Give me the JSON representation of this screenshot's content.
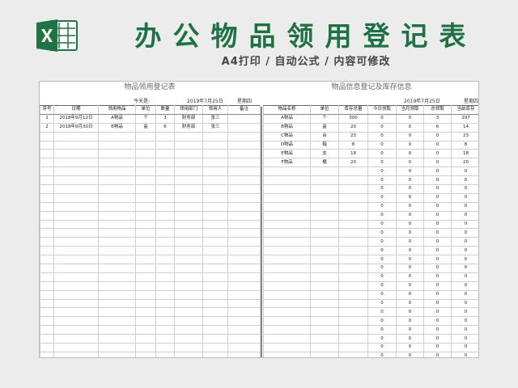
{
  "header": {
    "title": "办公物品领用登记表",
    "subtitle": "A4打印 / 自动公式 / 内容可修改"
  },
  "colors": {
    "brand_green": "#1e7145",
    "logo_green": "#217346"
  },
  "icons": {
    "logo": "excel-logo-icon"
  },
  "left_panel": {
    "title": "物品领用登记表",
    "today_label": "今天是:",
    "date": "2019年7月25日",
    "weekday": "星期四",
    "columns": [
      "序号",
      "日期",
      "领用物品",
      "单位",
      "数量",
      "领用部门",
      "领用人",
      "备注"
    ],
    "rows": [
      [
        "1",
        "2018年9月12日",
        "A物品",
        "个",
        "3",
        "财务部",
        "张三",
        ""
      ],
      [
        "2",
        "2018年9月30日",
        "B物品",
        "盒",
        "6",
        "财务部",
        "张三",
        ""
      ]
    ]
  },
  "right_panel": {
    "title": "物品信息登记及库存信息",
    "date": "2019年7月25日",
    "weekday": "星期四",
    "columns": [
      "物品名称",
      "单位",
      "库存总量",
      "今日领取",
      "当月领取",
      "总领取",
      "当前库存"
    ],
    "rows": [
      [
        "A物品",
        "个",
        "300",
        "0",
        "0",
        "3",
        "297"
      ],
      [
        "B物品",
        "盒",
        "20",
        "0",
        "0",
        "6",
        "14"
      ],
      [
        "C物品",
        "台",
        "23",
        "0",
        "0",
        "0",
        "23"
      ],
      [
        "D物品",
        "箱",
        "8",
        "0",
        "0",
        "0",
        "8"
      ],
      [
        "E物品",
        "支",
        "18",
        "0",
        "0",
        "0",
        "18"
      ],
      [
        "F物品",
        "桶",
        "20",
        "0",
        "0",
        "0",
        "20"
      ],
      [
        "",
        "",
        "",
        "0",
        "0",
        "0",
        "0"
      ],
      [
        "",
        "",
        "",
        "0",
        "0",
        "0",
        "0"
      ],
      [
        "",
        "",
        "",
        "0",
        "0",
        "0",
        "0"
      ],
      [
        "",
        "",
        "",
        "0",
        "0",
        "0",
        "0"
      ],
      [
        "",
        "",
        "",
        "0",
        "0",
        "0",
        "0"
      ],
      [
        "",
        "",
        "",
        "0",
        "0",
        "0",
        "0"
      ],
      [
        "",
        "",
        "",
        "0",
        "0",
        "0",
        "0"
      ],
      [
        "",
        "",
        "",
        "0",
        "0",
        "0",
        "0"
      ],
      [
        "",
        "",
        "",
        "0",
        "0",
        "0",
        "0"
      ],
      [
        "",
        "",
        "",
        "0",
        "0",
        "0",
        "0"
      ],
      [
        "",
        "",
        "",
        "0",
        "0",
        "0",
        "0"
      ],
      [
        "",
        "",
        "",
        "0",
        "0",
        "0",
        "0"
      ],
      [
        "",
        "",
        "",
        "0",
        "0",
        "0",
        "0"
      ],
      [
        "",
        "",
        "",
        "0",
        "0",
        "0",
        "0"
      ],
      [
        "",
        "",
        "",
        "0",
        "0",
        "0",
        "0"
      ],
      [
        "",
        "",
        "",
        "0",
        "0",
        "0",
        "0"
      ],
      [
        "",
        "",
        "",
        "0",
        "0",
        "0",
        "0"
      ],
      [
        "",
        "",
        "",
        "0",
        "0",
        "0",
        "0"
      ],
      [
        "",
        "",
        "",
        "0",
        "0",
        "0",
        "0"
      ],
      [
        "",
        "",
        "",
        "0",
        "0",
        "0",
        "0"
      ],
      [
        "",
        "",
        "",
        "0",
        "0",
        "0",
        "0"
      ],
      [
        "",
        "",
        "",
        "0",
        "0",
        "0",
        "0"
      ]
    ]
  }
}
